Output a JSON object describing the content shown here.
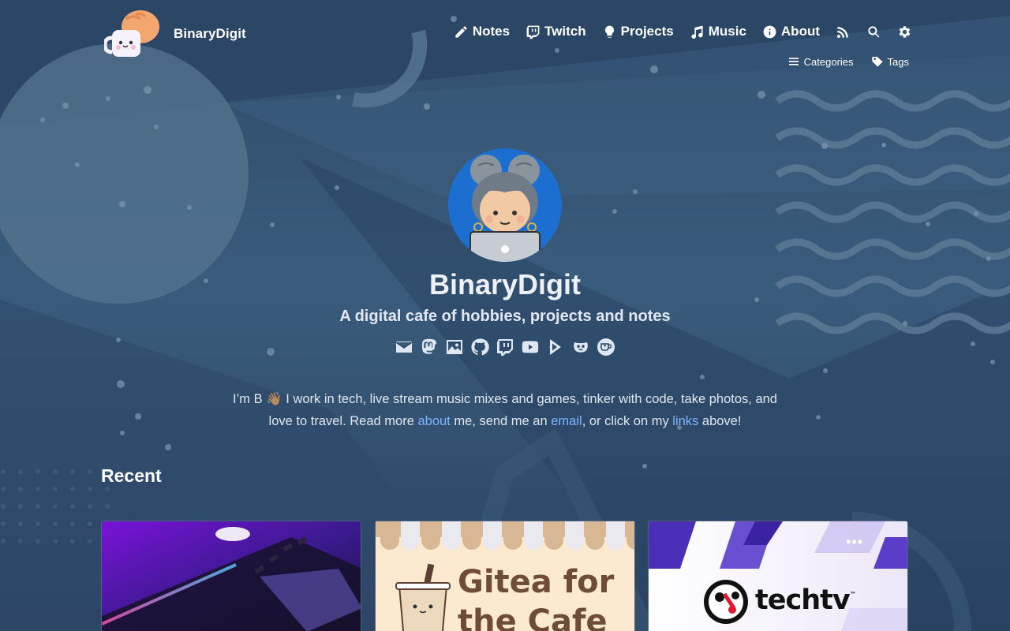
{
  "site": {
    "name": "BinaryDigit"
  },
  "nav": {
    "main": [
      {
        "label": "Notes",
        "icon": "pencil-icon"
      },
      {
        "label": "Twitch",
        "icon": "twitch-icon"
      },
      {
        "label": "Projects",
        "icon": "lightbulb-icon"
      },
      {
        "label": "Music",
        "icon": "music-note-icon"
      },
      {
        "label": "About",
        "icon": "info-circle-icon"
      }
    ],
    "icons": [
      "rss-icon",
      "search-icon",
      "gear-icon"
    ],
    "sub": [
      {
        "label": "Categories",
        "icon": "hamburger-icon"
      },
      {
        "label": "Tags",
        "icon": "tag-icon"
      }
    ]
  },
  "hero": {
    "title": "BinaryDigit",
    "tagline": "A digital cafe of hobbies, projects and notes",
    "social": [
      "email-icon",
      "mastodon-icon",
      "image-icon",
      "github-icon",
      "twitch-icon",
      "youtube-icon",
      "play-icon",
      "smile-icon",
      "kofi-icon"
    ]
  },
  "intro": {
    "part1": "I’m B 👋🏽 I work in tech, live stream music mixes and games, tinker with code, take photos, and love to travel. Read more ",
    "link_about": "about",
    "part2": " me, send me an ",
    "link_email": "email",
    "part3": ", or click on my ",
    "link_links": "links",
    "part4": " above!"
  },
  "recent": {
    "heading": "Recent",
    "cards": [
      {
        "image": "laptop-photo"
      },
      {
        "image": "gitea-cafe",
        "title_line1": "Gitea for",
        "title_line2": "the Cafe"
      },
      {
        "image": "techtv-logo",
        "brand": "techtv",
        "trademark": "™",
        "menu": "•••"
      }
    ]
  },
  "colors": {
    "background": "#2c4766",
    "link": "#7cb4ff",
    "text": "#e6ebf5"
  }
}
